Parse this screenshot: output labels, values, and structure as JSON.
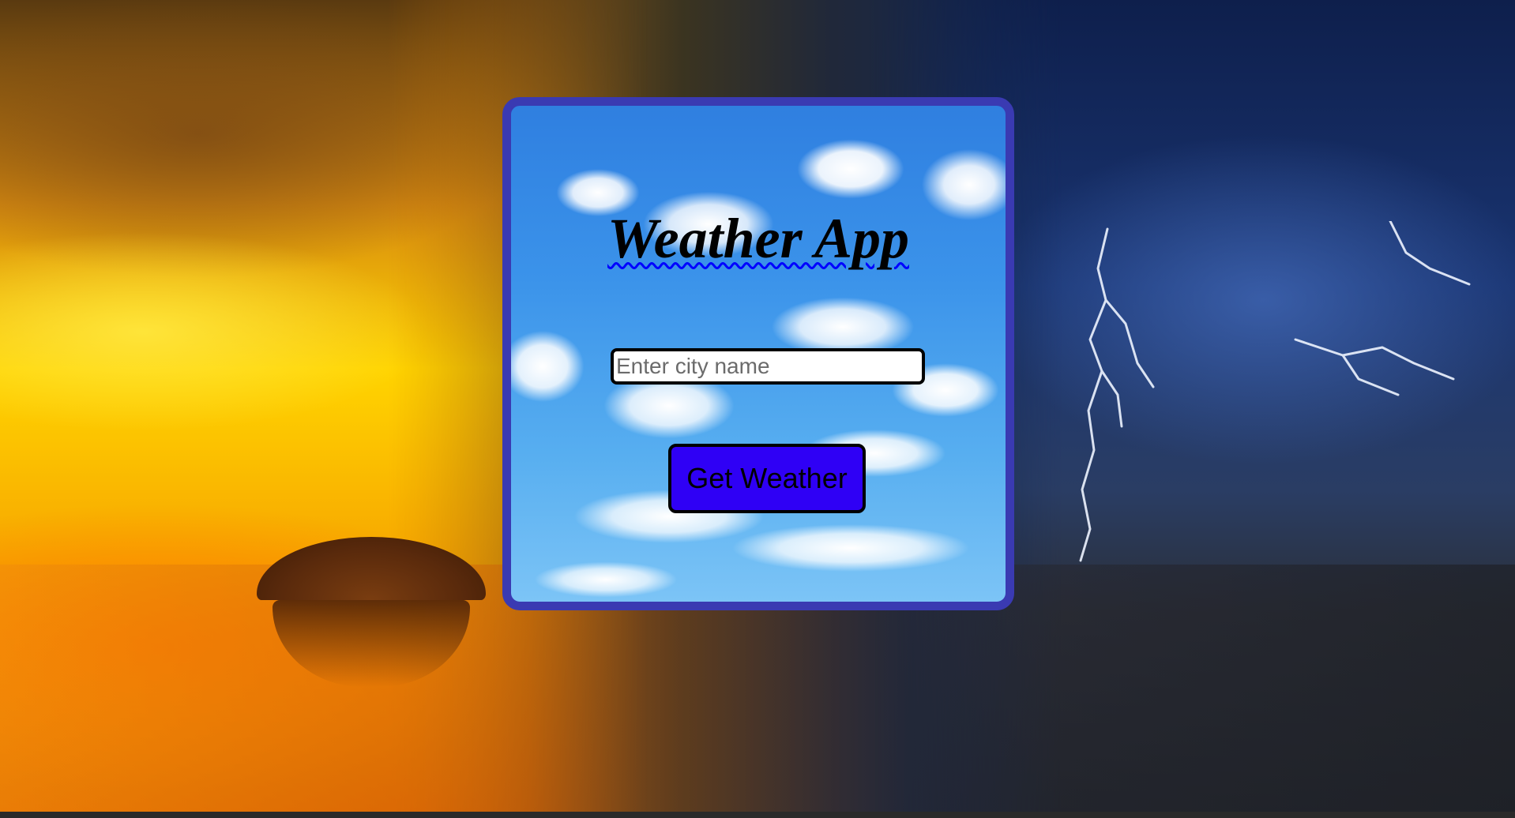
{
  "app": {
    "title": "Weather App"
  },
  "search": {
    "placeholder": "Enter city name",
    "value": ""
  },
  "actions": {
    "get_weather_label": "Get Weather"
  },
  "colors": {
    "card_border": "#3a3ab2",
    "button_background": "#2f00f5",
    "spellcheck_underline": "#0000ff"
  }
}
